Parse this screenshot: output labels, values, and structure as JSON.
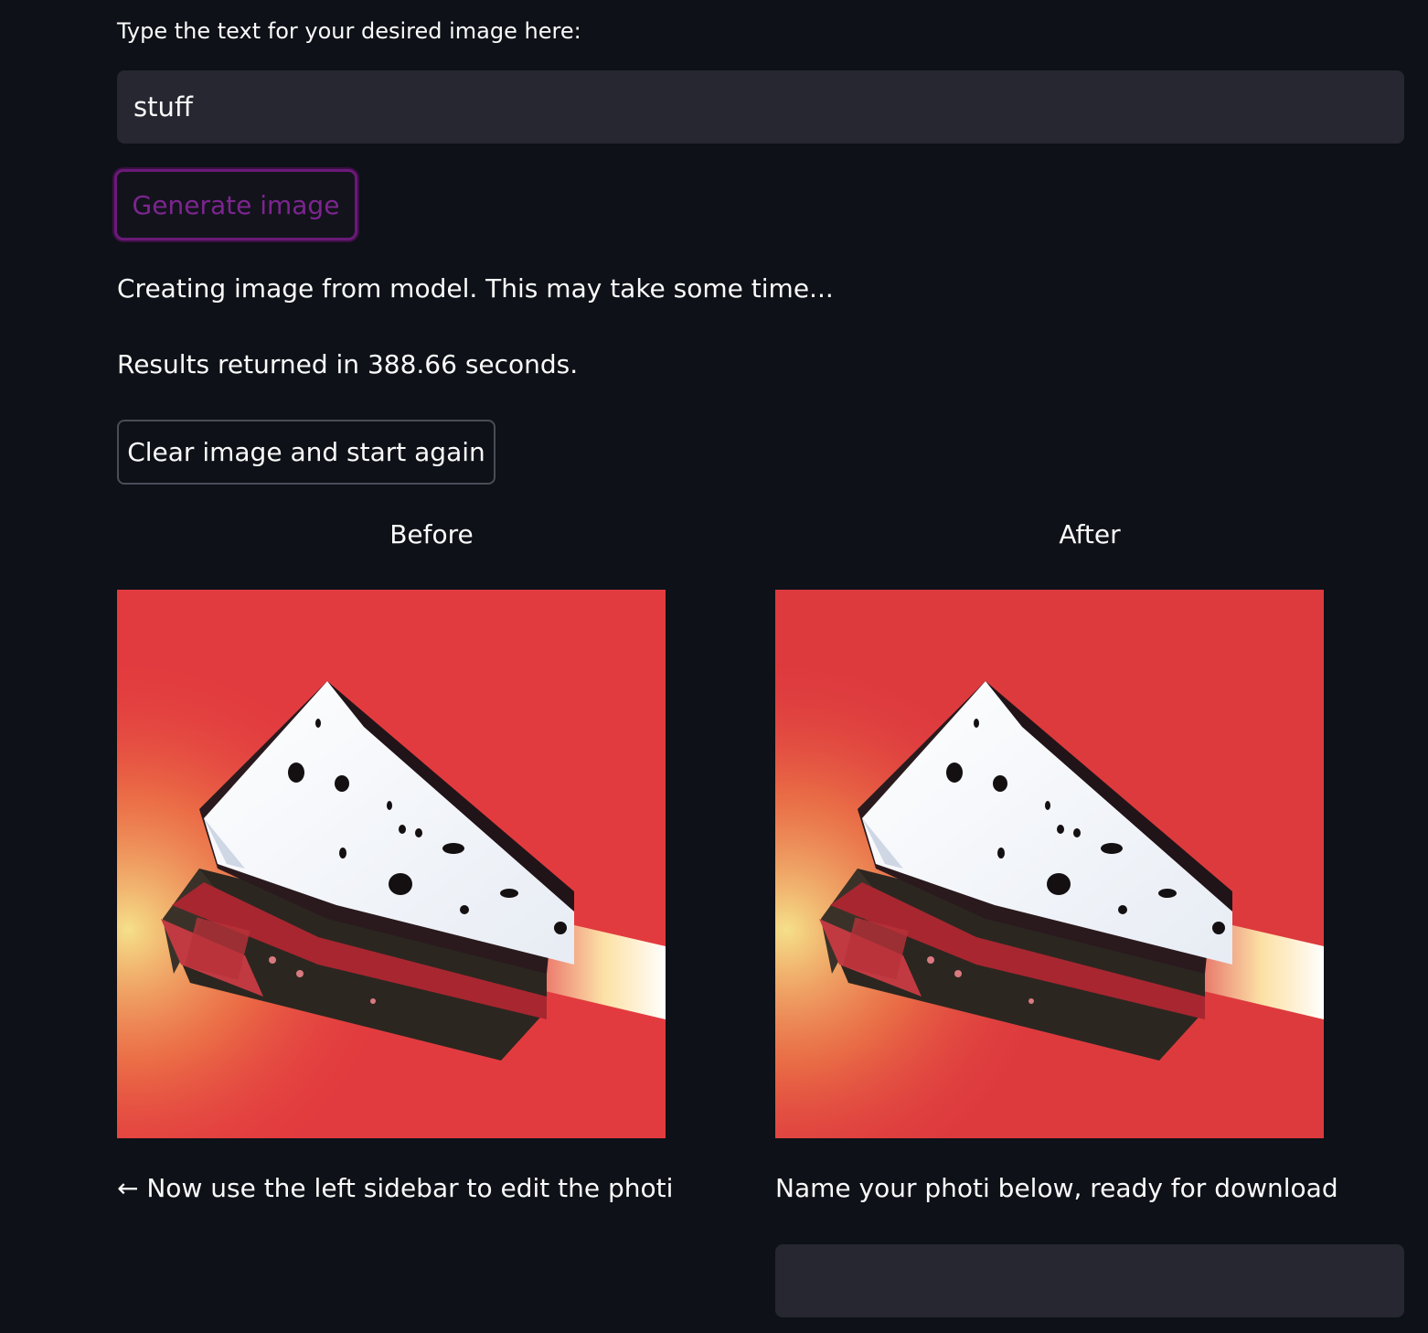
{
  "prompt": {
    "label": "Type the text for your desired image here:",
    "value": "stuff"
  },
  "generate_button": {
    "label": "Generate image"
  },
  "status": {
    "creating": "Creating image from model. This may take some time...",
    "results": "Results returned in 388.66 seconds."
  },
  "clear_button": {
    "label": "Clear image and start again"
  },
  "columns": {
    "before": {
      "title": "Before",
      "caption": "← Now use the left sidebar to edit the photi"
    },
    "after": {
      "title": "After",
      "caption": "Name your photi below, ready for download"
    }
  },
  "download_name": {
    "value": ""
  },
  "colors": {
    "background": "#0e1117",
    "input_bg": "#262730",
    "accent": "#7d2590",
    "image_bg": "#e23b3f"
  }
}
